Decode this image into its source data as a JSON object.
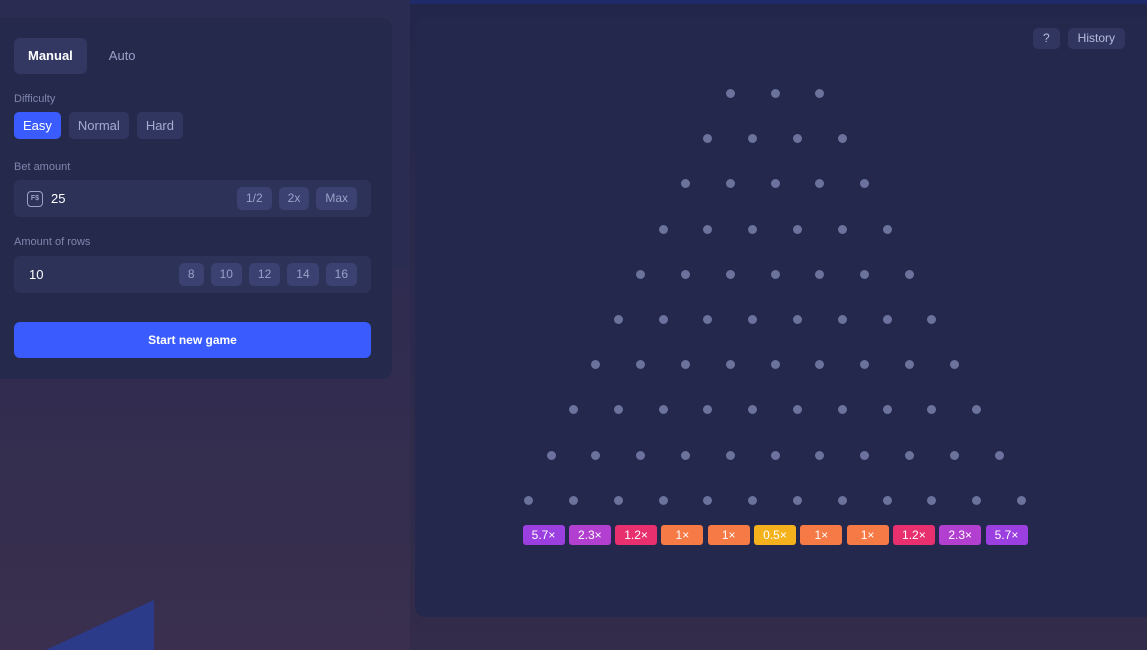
{
  "controls": {
    "mode_tabs": [
      {
        "label": "Manual",
        "active": true
      },
      {
        "label": "Auto",
        "active": false
      }
    ],
    "difficulty": {
      "label": "Difficulty",
      "options": [
        {
          "label": "Easy",
          "active": true
        },
        {
          "label": "Normal",
          "active": false
        },
        {
          "label": "Hard",
          "active": false
        }
      ]
    },
    "bet": {
      "label": "Bet amount",
      "currency_icon": "coin-icon",
      "currency_symbol": "F$",
      "value": "25",
      "buttons": [
        "1/2",
        "2x",
        "Max"
      ]
    },
    "rows": {
      "label": "Amount of rows",
      "value": "10",
      "options": [
        "8",
        "10",
        "12",
        "14",
        "16"
      ]
    },
    "start_label": "Start new game"
  },
  "board": {
    "help_label": "?",
    "history_label": "History",
    "peg_rows": 10,
    "first_row_pegs": 3,
    "multipliers": [
      {
        "label": "5.7×",
        "color": "#9b3fe0"
      },
      {
        "label": "2.3×",
        "color": "#b23fd0"
      },
      {
        "label": "1.2×",
        "color": "#e8306e"
      },
      {
        "label": "1×",
        "color": "#f57a45"
      },
      {
        "label": "1×",
        "color": "#f57a45"
      },
      {
        "label": "0.5×",
        "color": "#f5b21c"
      },
      {
        "label": "1×",
        "color": "#f57a45"
      },
      {
        "label": "1×",
        "color": "#f57a45"
      },
      {
        "label": "1.2×",
        "color": "#e8306e"
      },
      {
        "label": "2.3×",
        "color": "#b23fd0"
      },
      {
        "label": "5.7×",
        "color": "#9b3fe0"
      }
    ]
  },
  "colors": {
    "accent": "#3a5cff",
    "peg": "#6b729c"
  }
}
